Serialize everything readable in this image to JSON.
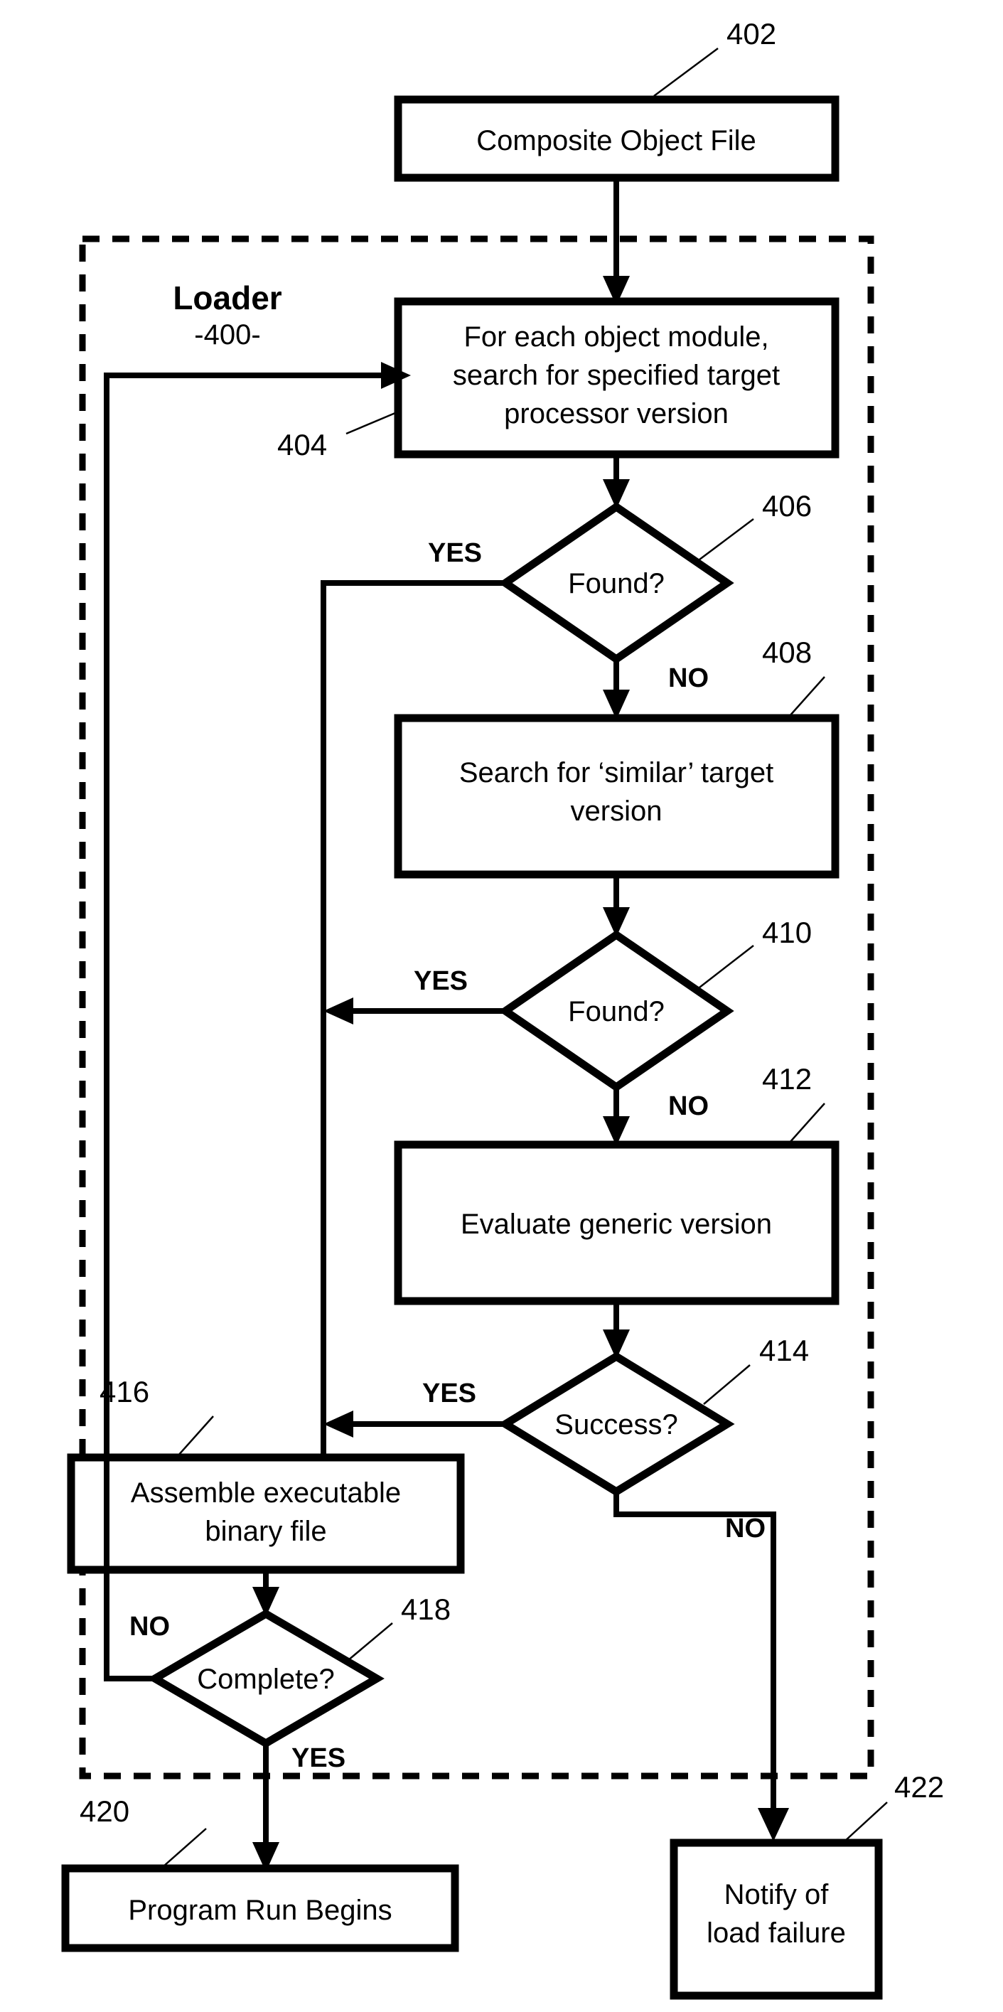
{
  "figure": {
    "type": "patent-flowchart",
    "container": {
      "title": "Loader",
      "reference": "-400-",
      "style": "dashed-boundary"
    },
    "nodes": [
      {
        "id": "402",
        "shape": "process",
        "text": "Composite Object File",
        "ref": "402"
      },
      {
        "id": "404",
        "shape": "process",
        "text_lines": [
          "For each object module,",
          "search for specified target",
          "processor version"
        ],
        "ref": "404"
      },
      {
        "id": "406",
        "shape": "decision",
        "text": "Found?",
        "ref": "406"
      },
      {
        "id": "408",
        "shape": "process",
        "text_lines": [
          "Search for ‘similar’ target",
          "version"
        ],
        "ref": "408"
      },
      {
        "id": "410",
        "shape": "decision",
        "text": "Found?",
        "ref": "410"
      },
      {
        "id": "412",
        "shape": "process",
        "text": "Evaluate generic version",
        "ref": "412"
      },
      {
        "id": "414",
        "shape": "decision",
        "text": "Success?",
        "ref": "414"
      },
      {
        "id": "416",
        "shape": "process",
        "text_lines": [
          "Assemble executable",
          "binary file"
        ],
        "ref": "416"
      },
      {
        "id": "418",
        "shape": "decision",
        "text": "Complete?",
        "ref": "418"
      },
      {
        "id": "420",
        "shape": "process",
        "text": "Program Run Begins",
        "ref": "420"
      },
      {
        "id": "422",
        "shape": "process",
        "text_lines": [
          "Notify of",
          "load failure"
        ],
        "ref": "422"
      }
    ],
    "edge_labels": {
      "found1_yes": "YES",
      "found1_no": "NO",
      "found2_yes": "YES",
      "found2_no": "NO",
      "success_yes": "YES",
      "success_no": "NO",
      "complete_no": "NO",
      "complete_yes": "YES"
    },
    "refs": {
      "r402": "402",
      "r404": "404",
      "r406": "406",
      "r408": "408",
      "r410": "410",
      "r412": "412",
      "r414": "414",
      "r416": "416",
      "r418": "418",
      "r420": "420",
      "r422": "422"
    },
    "text": {
      "t402": "Composite Object File",
      "t404a": "For each object module,",
      "t404b": "search for specified target",
      "t404c": "processor version",
      "t406": "Found?",
      "t408a": "Search for ‘similar’ target",
      "t408b": "version",
      "t410": "Found?",
      "t412": "Evaluate generic version",
      "t414": "Success?",
      "t416a": "Assemble executable",
      "t416b": "binary file",
      "t418": "Complete?",
      "t420": "Program Run Begins",
      "t422a": "Notify of",
      "t422b": "load failure",
      "loader_title": "Loader",
      "loader_num": "-400-"
    },
    "colors": {
      "stroke": "#000000",
      "fill": "#ffffff",
      "background": "#ffffff"
    }
  }
}
